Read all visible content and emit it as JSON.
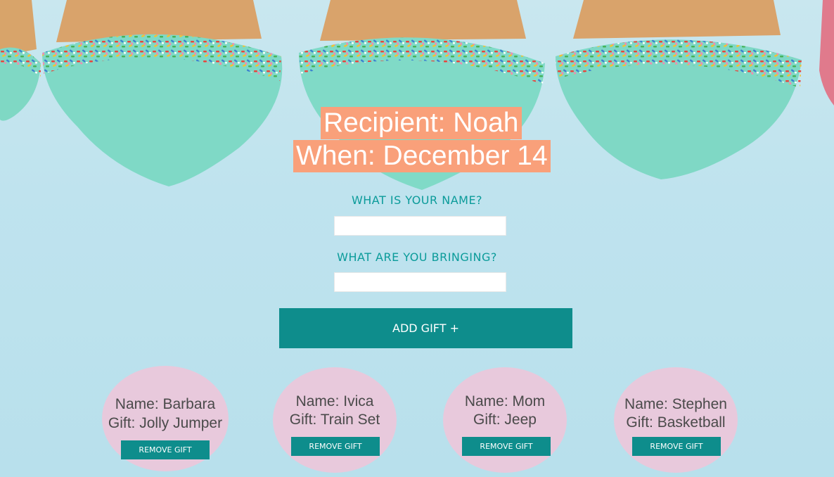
{
  "header": {
    "recipient": "Recipient: Noah",
    "when": "When: December 14"
  },
  "form": {
    "name_label": "What is your name?",
    "name_value": "",
    "gift_label": "What are you bringing?",
    "gift_value": "",
    "add_button": "Add Gift +"
  },
  "gifts": [
    {
      "name": "Name: Barbara",
      "gift": "Gift: Jolly  Jumper",
      "remove": "Remove Gift"
    },
    {
      "name": "Name: Ivica",
      "gift": "Gift: Train Set",
      "remove": "Remove Gift"
    },
    {
      "name": "Name: Mom",
      "gift": "Gift: Jeep",
      "remove": "Remove Gift"
    },
    {
      "name": "Name: Stephen",
      "gift": "Gift: Basketball",
      "remove": "Remove Gift"
    }
  ],
  "colors": {
    "accent": "#0e8d8c",
    "title_bg": "#f9a07a",
    "card_bg": "#e8c9dc",
    "label": "#0b9b9a"
  },
  "background": "cupcakes-with-sprinkles-image"
}
